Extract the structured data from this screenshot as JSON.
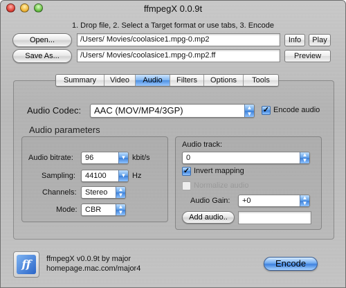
{
  "window": {
    "title": "ffmpegX 0.0.9t"
  },
  "instructions": "1. Drop file, 2. Select a Target format or use tabs, 3. Encode",
  "files": {
    "open_label": "Open...",
    "save_as_label": "Save As...",
    "source_path": "/Users/        Movies/coolasice1.mpg-0.mp2",
    "target_path": "/Users/        Movies/coolasice1.mpg-0.mp2.ff",
    "info_label": "Info",
    "play_label": "Play",
    "preview_label": "Preview"
  },
  "tabs": [
    {
      "label": "Summary",
      "active": false
    },
    {
      "label": "Video",
      "active": false
    },
    {
      "label": "Audio",
      "active": true
    },
    {
      "label": "Filters",
      "active": false
    },
    {
      "label": "Options",
      "active": false
    },
    {
      "label": "Tools",
      "active": false
    }
  ],
  "audio": {
    "codec_label": "Audio Codec:",
    "codec_value": "AAC (MOV/MP4/3GP)",
    "encode_audio_label": "Encode audio",
    "encode_audio_checked": true,
    "params_heading": "Audio parameters",
    "bitrate_label": "Audio bitrate:",
    "bitrate_value": "96",
    "bitrate_unit": "kbit/s",
    "sampling_label": "Sampling:",
    "sampling_value": "44100",
    "sampling_unit": "Hz",
    "channels_label": "Channels:",
    "channels_value": "Stereo",
    "mode_label": "Mode:",
    "mode_value": "CBR",
    "track_label": "Audio track:",
    "track_value": "0",
    "invert_label": "Invert mapping",
    "invert_checked": true,
    "normalize_label": "Normalize audio",
    "normalize_checked": false,
    "gain_label": "Audio Gain:",
    "gain_value": "+0",
    "add_audio_label": "Add audio..",
    "add_audio_field": ""
  },
  "footer": {
    "about_line1": "ffmpegX v0.0.9t by major",
    "about_line2": "homepage.mac.com/major4",
    "encode_label": "Encode",
    "icon_glyph": "ff"
  },
  "colors": {
    "accent": "#3e82df"
  }
}
